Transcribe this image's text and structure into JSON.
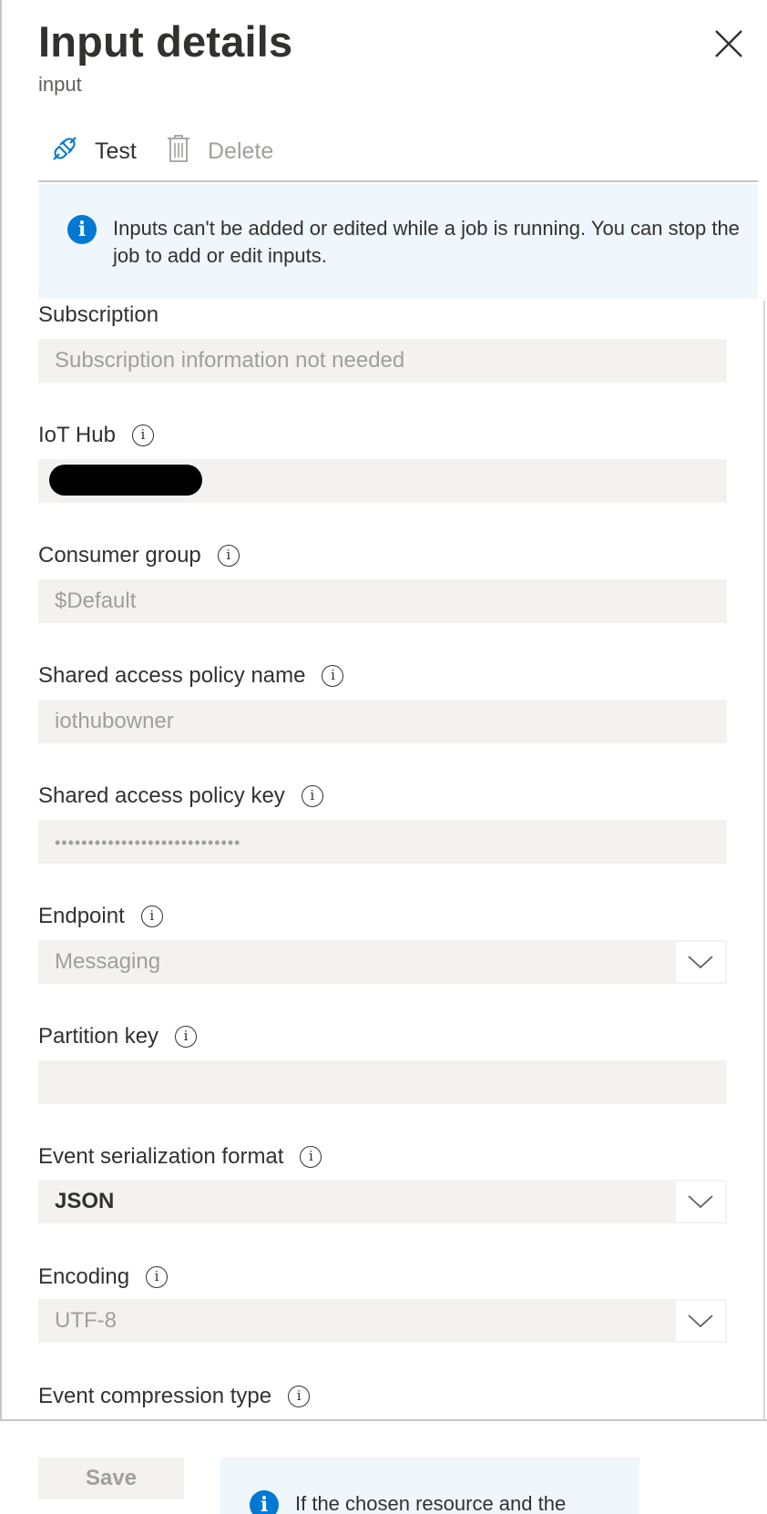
{
  "header": {
    "title": "Input details",
    "subtitle": "input",
    "close_icon": "close-icon"
  },
  "toolbar": {
    "test_label": "Test",
    "delete_label": "Delete"
  },
  "banner": {
    "icon": "info-icon",
    "text": "Inputs can't be added or edited while a job is running. You can stop the job to add or edit inputs."
  },
  "fields": {
    "subscription": {
      "label": "Subscription",
      "value": "Subscription information not needed"
    },
    "iot_hub": {
      "label": "IoT Hub",
      "value": ""
    },
    "consumer_group": {
      "label": "Consumer group",
      "value": "$Default"
    },
    "policy_name": {
      "label": "Shared access policy name",
      "value": "iothubowner"
    },
    "policy_key": {
      "label": "Shared access policy key",
      "value": "••••••••••••••••••••••••••••"
    },
    "endpoint": {
      "label": "Endpoint",
      "value": "Messaging"
    },
    "partition_key": {
      "label": "Partition key",
      "value": ""
    },
    "serialization": {
      "label": "Event serialization format",
      "value": "JSON"
    },
    "encoding": {
      "label": "Encoding",
      "value": "UTF-8"
    },
    "compression": {
      "label": "Event compression type"
    }
  },
  "footer": {
    "save_label": "Save",
    "banner_text": "If the chosen resource and the"
  },
  "colors": {
    "accent": "#0078d4",
    "banner_bg": "#eff6fc",
    "field_bg": "#f3f2f1",
    "disabled_text": "#a19f9d"
  }
}
